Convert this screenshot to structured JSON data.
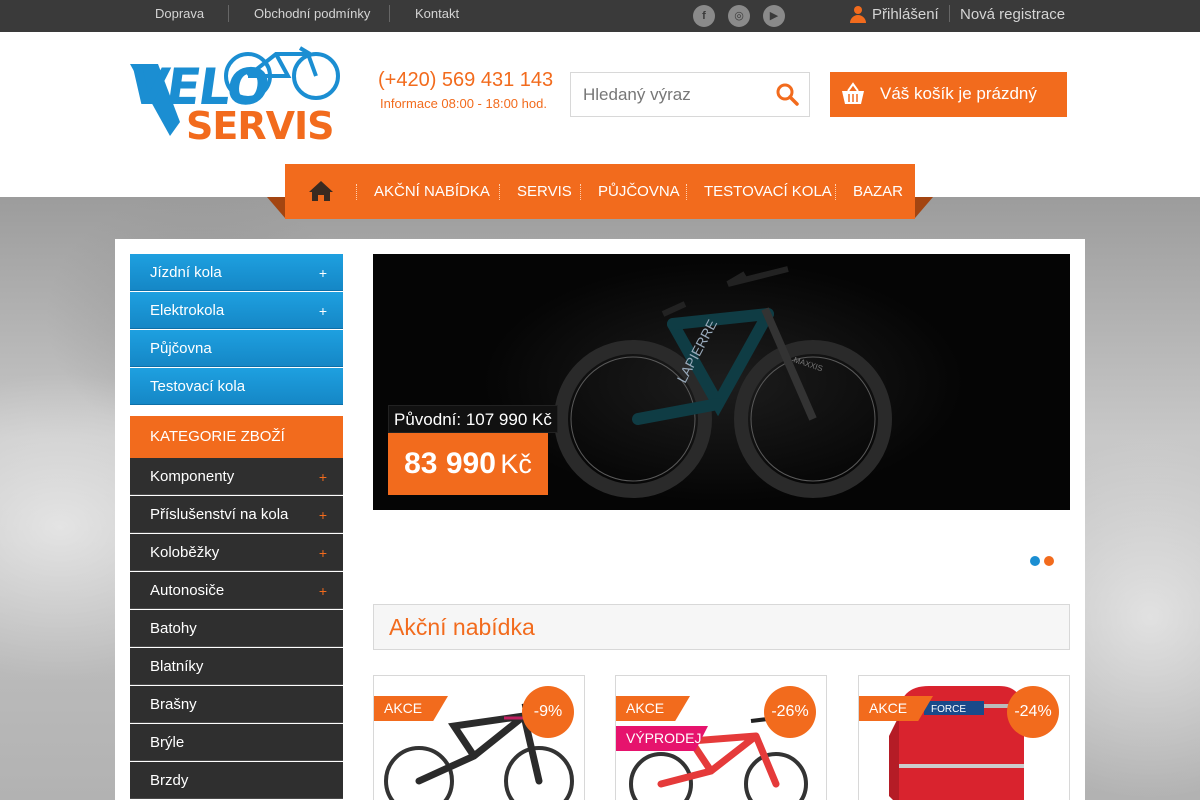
{
  "topbar": {
    "links": [
      "Doprava",
      "Obchodní podmínky",
      "Kontakt"
    ],
    "social": {
      "facebook": "f",
      "instagram": "◎",
      "youtube": "▶"
    },
    "login": "Přihlášení",
    "register": "Nová registrace"
  },
  "header": {
    "logo_top": "VELO",
    "logo_bottom": "SERVIS",
    "phone": "(+420) 569 431 143",
    "hours": "Informace 08:00 - 18:00 hod.",
    "search_placeholder": "Hledaný výraz",
    "cart_label": "Váš košík je prázdný"
  },
  "nav": {
    "items": [
      "AKČNÍ NABÍDKA",
      "SERVIS",
      "PŮJČOVNA",
      "TESTOVACÍ KOLA",
      "BAZAR"
    ]
  },
  "sidebar": {
    "blue": [
      {
        "label": "Jízdní kola",
        "plus": "+"
      },
      {
        "label": "Elektrokola",
        "plus": "+"
      },
      {
        "label": "Půjčovna",
        "plus": ""
      },
      {
        "label": "Testovací kola",
        "plus": ""
      }
    ],
    "category_header": "KATEGORIE ZBOŽÍ",
    "categories": [
      {
        "label": "Komponenty",
        "plus": "+"
      },
      {
        "label": "Příslušenství na kola",
        "plus": "+"
      },
      {
        "label": "Koloběžky",
        "plus": "+"
      },
      {
        "label": "Autonosiče",
        "plus": "+"
      },
      {
        "label": "Batohy",
        "plus": ""
      },
      {
        "label": "Blatníky",
        "plus": ""
      },
      {
        "label": "Brašny",
        "plus": ""
      },
      {
        "label": "Brýle",
        "plus": ""
      },
      {
        "label": "Brzdy",
        "plus": ""
      }
    ]
  },
  "slider": {
    "price_old": "Původní: 107 990 Kč",
    "price_new": "83 990",
    "currency": "Kč",
    "bike_brand": "LAPIERRE",
    "tire_brand": "MAXXIS",
    "dots": 2,
    "active_dot": 0
  },
  "offers": {
    "title": "Akční nabídka",
    "products": [
      {
        "tag": "AKCE",
        "discount": "-9%"
      },
      {
        "tag": "AKCE",
        "tag2": "VÝPRODEJ",
        "discount": "-26%"
      },
      {
        "tag": "AKCE",
        "discount": "-24%",
        "brand": "FORCE"
      }
    ]
  },
  "colors": {
    "accent": "#f26b1d",
    "blue": "#1b8ed2",
    "dark": "#2f2f2f",
    "pink": "#e6136d"
  }
}
